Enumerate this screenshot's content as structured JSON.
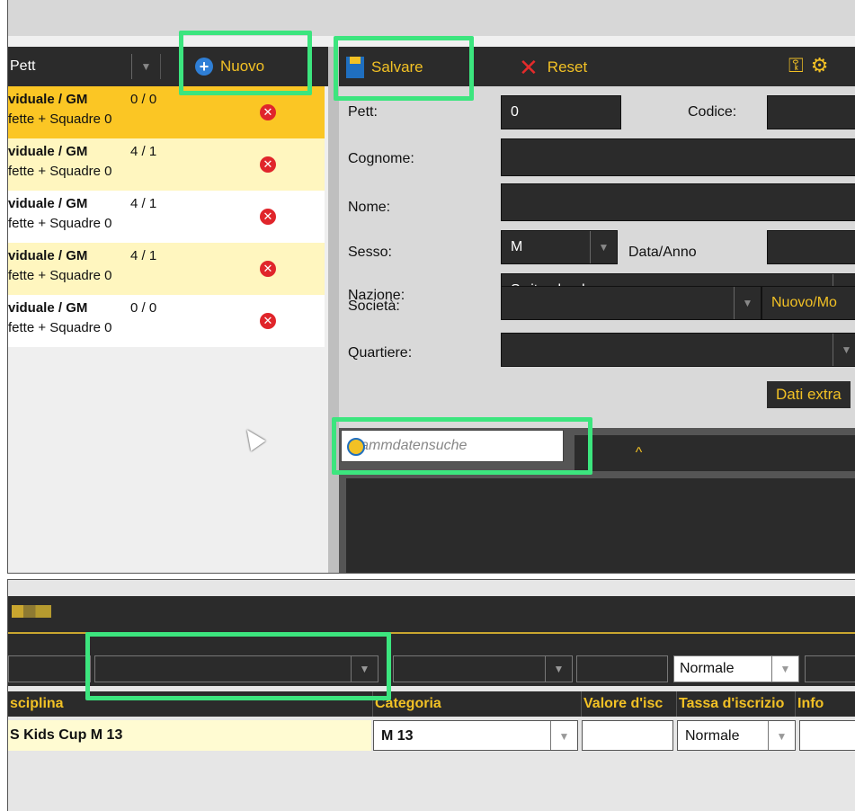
{
  "left_list": {
    "pett_select": "Pett",
    "new_button": "Nuovo",
    "rows": [
      {
        "line1": "viduale / GM",
        "score": "0 / 0",
        "line2": "fette + Squadre 0",
        "bg": "#fbc624"
      },
      {
        "line1": "viduale / GM",
        "score": "4 / 1",
        "line2": "fette + Squadre 0",
        "bg": "#fff6bf"
      },
      {
        "line1": "viduale / GM",
        "score": "4 / 1",
        "line2": "fette + Squadre 0",
        "bg": "#ffffff"
      },
      {
        "line1": "viduale / GM",
        "score": "4 / 1",
        "line2": "fette + Squadre 0",
        "bg": "#fff6bf"
      },
      {
        "line1": "viduale / GM",
        "score": "0 / 0",
        "line2": "fette + Squadre 0",
        "bg": "#ffffff"
      }
    ]
  },
  "toolbar": {
    "save_label": "Salvare",
    "reset_label": "Reset"
  },
  "form": {
    "pett_label": "Pett:",
    "pett_value": "0",
    "codice_label": "Codice:",
    "cognome_label": "Cognome:",
    "nome_label": "Nome:",
    "sesso_label": "Sesso:",
    "sesso_value": "M",
    "data_label": "Data/Anno",
    "nazione_label": "Nazione:",
    "nazione_value": "Switzerland",
    "societa_label": "Società:",
    "nuovo_mod_label": "Nuovo/Mo",
    "quartiere_label": "Quartiere:",
    "dati_extra_label": "Dati extra"
  },
  "search": {
    "placeholder": "Stammdatensuche",
    "caret": "^"
  },
  "bottom": {
    "normale_label": "Normale",
    "headers": [
      "sciplina",
      "Categoria",
      "Valore d'isc",
      "Tassa d'iscrizio",
      "Info"
    ],
    "row": {
      "disciplina": "S Kids Cup M 13",
      "categoria": "M 13",
      "tassa": "Normale"
    }
  },
  "colors": {
    "accent": "#f2c125",
    "highlight": "#3ce57e",
    "toolbar": "#2b2b2b"
  }
}
